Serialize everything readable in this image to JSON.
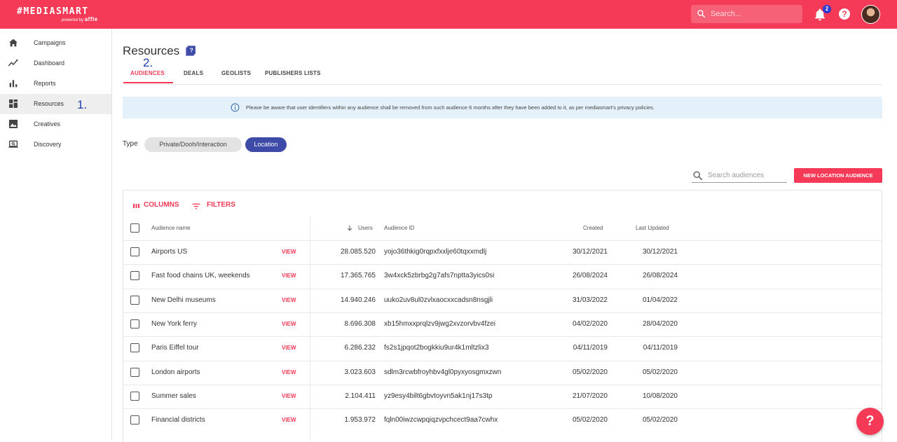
{
  "brand": {
    "logo": "MEDIASMART",
    "hash": "#",
    "powered_by": "powered by",
    "parent": "affle"
  },
  "header": {
    "search_placeholder": "Search...",
    "notifications_count": "2",
    "help_symbol": "?"
  },
  "sidebar": {
    "items": [
      {
        "label": "Campaigns",
        "icon": "home-icon"
      },
      {
        "label": "Dashboard",
        "icon": "trend-icon"
      },
      {
        "label": "Reports",
        "icon": "bar-chart-icon"
      },
      {
        "label": "Resources",
        "icon": "dashboard-grid-icon",
        "active": true
      },
      {
        "label": "Creatives",
        "icon": "image-icon"
      },
      {
        "label": "Discovery",
        "icon": "laptop-search-icon"
      }
    ]
  },
  "annotations": {
    "step1": "1.",
    "step2": "2."
  },
  "page": {
    "title": "Resources",
    "tabs": [
      "AUDIENCES",
      "DEALS",
      "GEOLISTS",
      "PUBLISHERS LISTS"
    ],
    "active_tab": "AUDIENCES",
    "notice": "Please be aware that user identifiers within any audience shall be removed from such audience 6 months after they have been added to it, as per mediasmart's privacy policies.",
    "type_label": "Type",
    "type_options": [
      "Private/Dooh/Interaction",
      "Location"
    ],
    "selected_type": "Location",
    "search_placeholder": "Search audiences",
    "new_button": "NEW LOCATION AUDIENCE",
    "toolbar": {
      "columns": "COLUMNS",
      "filters": "FILTERS"
    }
  },
  "table": {
    "headers": {
      "name": "Audience name",
      "users": "Users",
      "id": "Audience ID",
      "created": "Created",
      "updated": "Last Updated"
    },
    "sort": {
      "column": "Users",
      "direction": "descending"
    },
    "view_label": "VIEW",
    "rows": [
      {
        "name": "Airports US",
        "users": "28.085.520",
        "id": "yojo36thkig0rqpxfxxlje60tqxxmdlj",
        "created": "30/12/2021",
        "updated": "30/12/2021"
      },
      {
        "name": "Fast food chains UK, weekends",
        "users": "17.365.765",
        "id": "3w4xck5zbrbg2g7afs7nptta3yics0si",
        "created": "26/08/2024",
        "updated": "26/08/2024"
      },
      {
        "name": "New Delhi museums",
        "users": "14.940.246",
        "id": "uuko2uv8ul0zvlxaocxxcadsn8nsgjli",
        "created": "31/03/2022",
        "updated": "01/04/2022"
      },
      {
        "name": "New York ferry",
        "users": "8.696.308",
        "id": "xb15hmxxprqlzv9jwg2xvzorvbv4fzei",
        "created": "04/02/2020",
        "updated": "28/04/2020"
      },
      {
        "name": "Paris Eiffel tour",
        "users": "6.286.232",
        "id": "fs2s1jpqot2bogkkiu9ur4k1mltzlix3",
        "created": "04/11/2019",
        "updated": "04/11/2019"
      },
      {
        "name": "London airports",
        "users": "3.023.603",
        "id": "sdlm3rcwbfroyhbv4gl0pyxyosgmxzwn",
        "created": "05/02/2020",
        "updated": "05/02/2020"
      },
      {
        "name": "Summer sales",
        "users": "2.104.411",
        "id": "yz9esy4bilt6gbvtoyvn5ak1nj17s3tp",
        "created": "21/07/2020",
        "updated": "10/08/2020"
      },
      {
        "name": "Financial districts",
        "users": "1.953.972",
        "id": "fqln00iwzcwpqiqzvpchcect9aa7cwhx",
        "created": "05/02/2020",
        "updated": "05/02/2020"
      }
    ]
  },
  "colors": {
    "brand": "#f43a56",
    "chip_selected": "#3e4aa8",
    "notice_bg": "#e4f1fa"
  }
}
